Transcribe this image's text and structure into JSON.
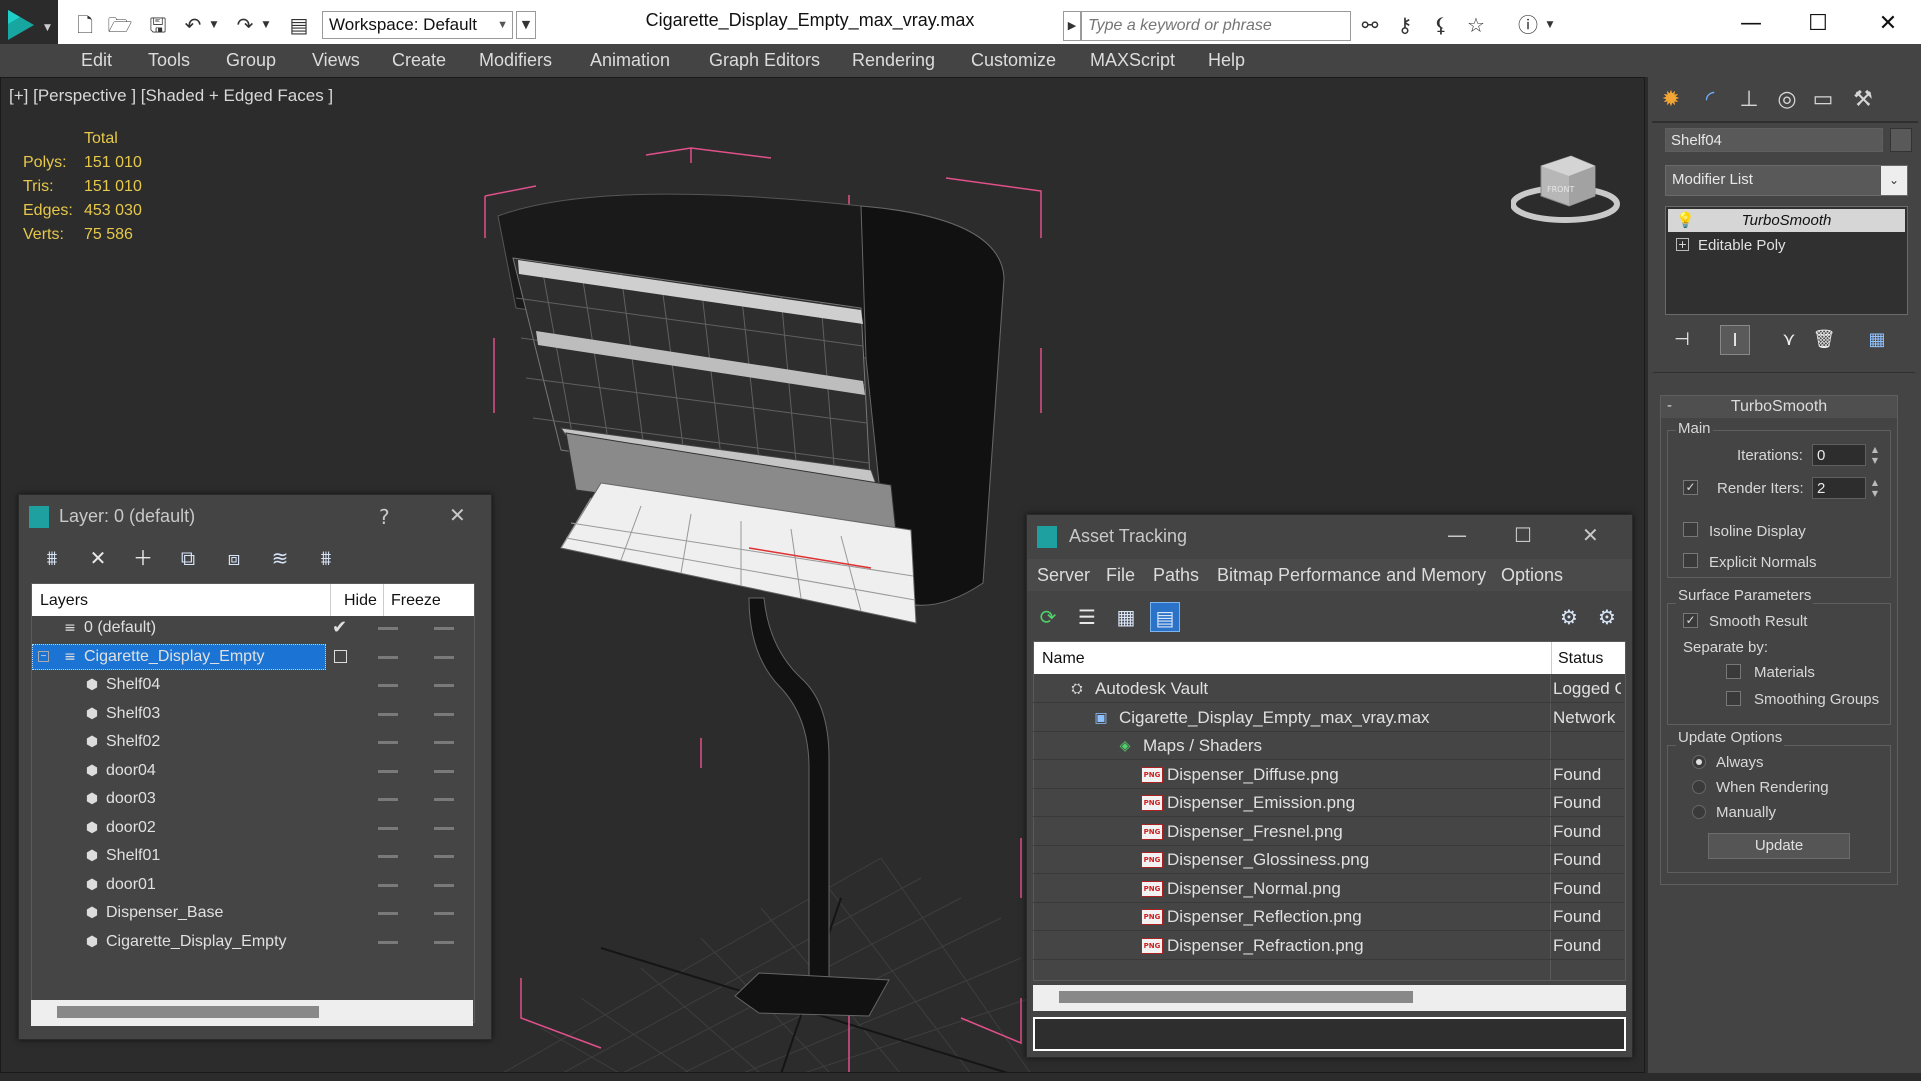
{
  "titlebar": {
    "workspace": "Workspace: Default",
    "doc_title": "Cigarette_Display_Empty_max_vray.max",
    "search_placeholder": "Type a keyword or phrase"
  },
  "menu": [
    "Edit",
    "Tools",
    "Group",
    "Views",
    "Create",
    "Modifiers",
    "Animation",
    "Graph Editors",
    "Rendering",
    "Customize",
    "MAXScript",
    "Help"
  ],
  "viewport": {
    "label": "[+] [Perspective ] [Shaded + Edged Faces ]",
    "stats_header": "Total",
    "stats": [
      {
        "label": "Polys:",
        "value": "151 010"
      },
      {
        "label": "Tris:",
        "value": "151 010"
      },
      {
        "label": "Edges:",
        "value": "453 030"
      },
      {
        "label": "Verts:",
        "value": "75 586"
      }
    ],
    "viewcube_face": "FRONT"
  },
  "command_panel": {
    "object_name": "Shelf04",
    "modifier_list": "Modifier List",
    "stack": [
      "TurboSmooth",
      "Editable Poly"
    ],
    "rollout_title": "TurboSmooth",
    "main_group": "Main",
    "iterations_label": "Iterations:",
    "iterations_value": "0",
    "render_iters_label": "Render Iters:",
    "render_iters_value": "2",
    "isoline_display": "Isoline Display",
    "explicit_normals": "Explicit Normals",
    "surface_group": "Surface Parameters",
    "smooth_result": "Smooth Result",
    "separate_by": "Separate by:",
    "materials": "Materials",
    "smoothing_groups": "Smoothing Groups",
    "update_group": "Update Options",
    "always": "Always",
    "when_rendering": "When Rendering",
    "manually": "Manually",
    "update_button": "Update"
  },
  "layer_dialog": {
    "title": "Layer: 0 (default)",
    "help": "?",
    "col_layers": "Layers",
    "col_hide": "Hide",
    "col_freeze": "Freeze",
    "rows": [
      {
        "name": "0 (default)",
        "level": 0
      },
      {
        "name": "Cigarette_Display_Empty",
        "level": 0
      },
      {
        "name": "Shelf04",
        "level": 1
      },
      {
        "name": "Shelf03",
        "level": 1
      },
      {
        "name": "Shelf02",
        "level": 1
      },
      {
        "name": "door04",
        "level": 1
      },
      {
        "name": "door03",
        "level": 1
      },
      {
        "name": "door02",
        "level": 1
      },
      {
        "name": "Shelf01",
        "level": 1
      },
      {
        "name": "door01",
        "level": 1
      },
      {
        "name": "Dispenser_Base",
        "level": 1
      },
      {
        "name": "Cigarette_Display_Empty",
        "level": 1
      }
    ]
  },
  "asset_dialog": {
    "title": "Asset Tracking",
    "menu": [
      "Server",
      "File",
      "Paths",
      "Bitmap Performance and Memory",
      "Options"
    ],
    "col_name": "Name",
    "col_status": "Status",
    "rows": [
      {
        "name": "Autodesk Vault",
        "status": "Logged C",
        "level": 0
      },
      {
        "name": "Cigarette_Display_Empty_max_vray.max",
        "status": "Network",
        "level": 1
      },
      {
        "name": "Maps / Shaders",
        "status": "",
        "level": 2
      },
      {
        "name": "Dispenser_Diffuse.png",
        "status": "Found",
        "level": 3
      },
      {
        "name": "Dispenser_Emission.png",
        "status": "Found",
        "level": 3
      },
      {
        "name": "Dispenser_Fresnel.png",
        "status": "Found",
        "level": 3
      },
      {
        "name": "Dispenser_Glossiness.png",
        "status": "Found",
        "level": 3
      },
      {
        "name": "Dispenser_Normal.png",
        "status": "Found",
        "level": 3
      },
      {
        "name": "Dispenser_Reflection.png",
        "status": "Found",
        "level": 3
      },
      {
        "name": "Dispenser_Refraction.png",
        "status": "Found",
        "level": 3
      }
    ]
  },
  "colors": {
    "stats_yellow": "#e6c84a",
    "selection_blue": "#1b73d4",
    "bbox_pink": "#e0508a"
  }
}
